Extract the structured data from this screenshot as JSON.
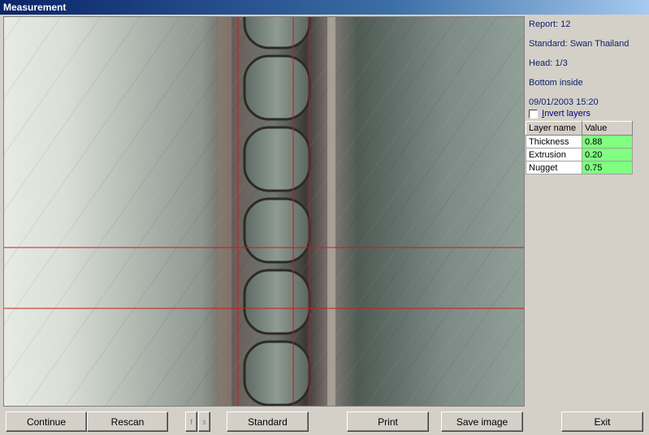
{
  "window": {
    "title": "Measurement"
  },
  "info": {
    "report": "Report: 12",
    "standard": "Standard: Swan Thailand",
    "head": "Head: 1/3",
    "position": "Bottom inside",
    "datetime": "09/01/2003 15:20"
  },
  "invert_layers": {
    "prefix": "I",
    "rest": "nvert layers",
    "checked": false
  },
  "layers_table": {
    "columns": [
      "Layer name",
      "Value"
    ],
    "rows": [
      {
        "name": "Thickness",
        "value": "0.88"
      },
      {
        "name": "Extrusion",
        "value": "0.20"
      },
      {
        "name": "Nugget",
        "value": "0.75"
      }
    ],
    "value_color": "#80ff80"
  },
  "buttons": {
    "continue": "Continue",
    "rescan": "Rescan",
    "f": "f",
    "s": "s",
    "standard": "Standard",
    "print": "Print",
    "save_image": "Save image",
    "exit": "Exit"
  },
  "overlay": {
    "line_color": "#cc1a1a"
  }
}
